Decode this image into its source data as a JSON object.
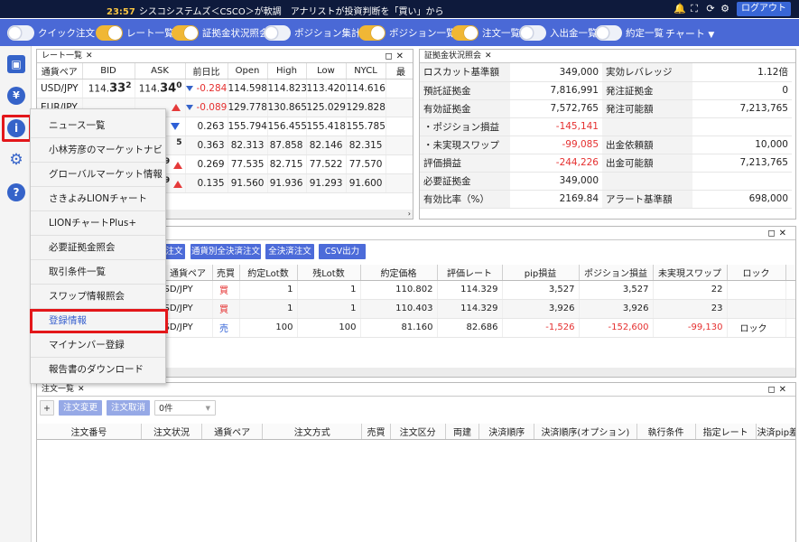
{
  "header": {
    "time": "23:57",
    "ticker": "シスコシステムズ＜CSCO＞が軟調　アナリストが投資判断を「買い」から「中立」に引き下",
    "logout_label": "ログアウト"
  },
  "toggles": [
    {
      "label": "クイック注文",
      "on": false
    },
    {
      "label": "レート一覧",
      "on": true
    },
    {
      "label": "証拠金状況照会",
      "on": true
    },
    {
      "label": "ポジション集計",
      "on": false
    },
    {
      "label": "ポジション一覧",
      "on": true
    },
    {
      "label": "注文一覧",
      "on": true
    },
    {
      "label": "入出金一覧",
      "on": false
    },
    {
      "label": "約定一覧",
      "on": false
    }
  ],
  "chart_menu_label": "チャート",
  "rate_panel": {
    "title": "レート一覧",
    "headers": [
      "通貨ペア",
      "BID",
      "ASK",
      "前日比",
      "Open",
      "High",
      "Low",
      "NYCL",
      "最"
    ],
    "rows": [
      {
        "pair": "USD/JPY",
        "bid_a": "114.",
        "bid_b": "33",
        "bid_c": "2",
        "ask_a": "114.",
        "ask_b": "34",
        "ask_c": "0",
        "change": "-0.284",
        "open": "114.598",
        "high": "114.823",
        "low": "113.420",
        "nycl": "114.616"
      },
      {
        "pair": "EUR/JPY",
        "bid_a": "",
        "bid_b": "",
        "bid_c": "",
        "ask_a": "",
        "ask_b": "",
        "ask_c": "",
        "change": "-0.089",
        "open": "129.778",
        "high": "130.865",
        "low": "125.029",
        "nycl": "129.828"
      },
      {
        "pair": "",
        "bid_a": "",
        "bid_b": "",
        "bid_c": "",
        "ask_a": "",
        "ask_b": "",
        "ask_c": "5",
        "change": "0.263",
        "open": "155.794",
        "high": "156.455",
        "low": "155.418",
        "nycl": "155.785"
      },
      {
        "pair": "",
        "bid_a": "",
        "bid_b": "",
        "bid_c": "",
        "ask_a": "",
        "ask_b": "",
        "ask_c": "5",
        "change": "0.363",
        "open": "82.313",
        "high": "87.858",
        "low": "82.146",
        "nycl": "82.315"
      },
      {
        "pair": "",
        "bid_a": "",
        "bid_b": "",
        "bid_c": "",
        "ask_a": "",
        "ask_b": "",
        "ask_c": "9",
        "change": "0.269",
        "open": "77.535",
        "high": "82.715",
        "low": "77.522",
        "nycl": "77.570"
      },
      {
        "pair": "",
        "bid_a": "",
        "bid_b": "",
        "bid_c": "",
        "ask_a": "",
        "ask_b": "",
        "ask_c": "9",
        "change": "0.135",
        "open": "91.560",
        "high": "91.936",
        "low": "91.293",
        "nycl": "91.600"
      }
    ]
  },
  "margin_panel": {
    "title": "証拠金状況照会",
    "rows": [
      [
        "ロスカット基準額",
        "349,000",
        "実効レバレッジ",
        "1.12倍"
      ],
      [
        "預託証拠金",
        "7,816,991",
        "発注証拠金",
        "0"
      ],
      [
        "有効証拠金",
        "7,572,765",
        "発注可能額",
        "7,213,765"
      ],
      [
        "・ポジション損益",
        "-145,141",
        "",
        ""
      ],
      [
        "・未実現スワップ",
        "-99,085",
        "出金依頼額",
        "10,000"
      ],
      [
        "評価損益",
        "-244,226",
        "出金可能額",
        "7,213,765"
      ],
      [
        "必要証拠金",
        "349,000",
        "",
        ""
      ],
      [
        "有効比率（%）",
        "2169.84",
        "アラート基準額",
        "698,000"
      ]
    ]
  },
  "position_panel": {
    "buttons": [
      "注文",
      "通貨別全決済注文",
      "全決済注文",
      "CSV出力"
    ],
    "headers": [
      "",
      "通貨ペア",
      "売買",
      "約定Lot数",
      "残Lot数",
      "約定価格",
      "評価レート",
      "pip損益",
      "ポジション損益",
      "未実現スワップ",
      "ロック",
      ""
    ],
    "rows": [
      {
        "pair": "SD/JPY",
        "side": "買",
        "lot": "1",
        "remain": "1",
        "price": "110.802",
        "rate": "114.329",
        "pip": "3,527",
        "pl": "3,527",
        "swap": "22",
        "lock": ""
      },
      {
        "pair": "SD/JPY",
        "side": "買",
        "lot": "1",
        "remain": "1",
        "price": "110.403",
        "rate": "114.329",
        "pip": "3,926",
        "pl": "3,926",
        "swap": "23",
        "lock": ""
      },
      {
        "pair": "SD/JPY",
        "side": "売",
        "lot": "100",
        "remain": "100",
        "price": "81.160",
        "rate": "82.686",
        "pip": "-1,526",
        "pl": "-152,600",
        "swap": "-99,130",
        "lock": "ロック"
      }
    ]
  },
  "order_panel": {
    "title": "注文一覧",
    "add_label": "+",
    "change_label": "注文変更",
    "cancel_label": "注文取消",
    "count_label": "0件",
    "headers": [
      "注文番号",
      "注文状況",
      "通貨ペア",
      "注文方式",
      "売買",
      "注文区分",
      "両建",
      "決済順序",
      "決済順序(オプション)",
      "執行条件",
      "指定レート",
      "決済pip差"
    ]
  },
  "dropdown": {
    "items": [
      "ニュース一覧",
      "小林芳彦のマーケットナビ",
      "グローバルマーケット情報",
      "さきよみLIONチャート",
      "LIONチャートPlus+",
      "必要証拠金照会",
      "取引条件一覧",
      "スワップ情報照会",
      "登録情報",
      "マイナンバー登録",
      "報告書のダウンロード"
    ],
    "selected_index": 8
  },
  "colors": {
    "header_bg": "#0e1a3c",
    "toolbar_bg": "#4a69d6",
    "toggle_on": "#f0b735",
    "highlight": "#e3171a",
    "negative": "#e53030",
    "sell": "#2e5fd6"
  },
  "icons": {
    "bell": "bell-icon",
    "fullscreen": "fullscreen-icon",
    "refresh": "refresh-icon",
    "settings": "gear-icon"
  }
}
